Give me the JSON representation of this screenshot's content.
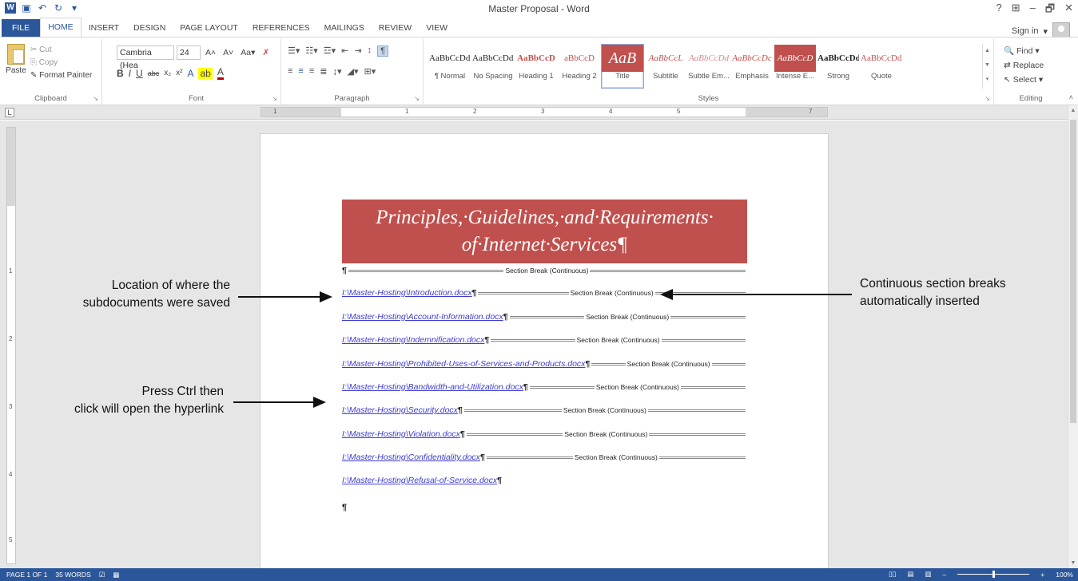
{
  "window": {
    "title": "Master Proposal - Word",
    "controls": [
      "?",
      "⊞",
      "–",
      "🗗",
      "✕"
    ],
    "sign_in": "Sign in"
  },
  "tabs": [
    "FILE",
    "HOME",
    "INSERT",
    "DESIGN",
    "PAGE LAYOUT",
    "REFERENCES",
    "MAILINGS",
    "REVIEW",
    "VIEW"
  ],
  "ribbon": {
    "clipboard": {
      "paste": "Paste",
      "cut": "Cut",
      "copy": "Copy",
      "format_painter": "Format Painter",
      "label": "Clipboard"
    },
    "font": {
      "name": "Cambria (Hea",
      "size": "24",
      "label": "Font"
    },
    "paragraph": {
      "label": "Paragraph"
    },
    "styles": {
      "label": "Styles",
      "items": [
        {
          "sample": "AaBbCcDdi",
          "name": "¶ Normal"
        },
        {
          "sample": "AaBbCcDdi",
          "name": "No Spacing"
        },
        {
          "sample": "AaBbCcD",
          "name": "Heading 1"
        },
        {
          "sample": "aBbCcD",
          "name": "Heading 2"
        },
        {
          "sample": "AaB",
          "name": "Title"
        },
        {
          "sample": "AaBbCcL",
          "name": "Subtitle"
        },
        {
          "sample": "AaBbCcDd",
          "name": "Subtle Em..."
        },
        {
          "sample": "AaBbCcDc",
          "name": "Emphasis"
        },
        {
          "sample": "AaBbCcD",
          "name": "Intense E..."
        },
        {
          "sample": "AaBbCcDd",
          "name": "Strong"
        },
        {
          "sample": "AaBbCcDdI",
          "name": "Quote"
        }
      ]
    },
    "editing": {
      "find": "Find",
      "replace": "Replace",
      "select": "Select",
      "label": "Editing"
    }
  },
  "document": {
    "title_line1": "Principles,·Guidelines,·and·Requirements·",
    "title_line2": "of·Internet·Services¶",
    "section_break": "Section Break (Continuous)",
    "subdocuments": [
      "I:\\Master-Hosting\\Introduction.docx",
      "I:\\Master-Hosting\\Account-Information.docx",
      "I:\\Master-Hosting\\Indemnification.docx",
      "I:\\Master-Hosting\\Prohibited-Uses-of-Services-and-Products.docx",
      "I:\\Master-Hosting\\Bandwidth-and-Utilization.docx",
      "I:\\Master-Hosting\\Security.docx",
      "I:\\Master-Hosting\\Violation.docx",
      "I:\\Master-Hosting\\Confidentiality.docx",
      "I:\\Master-Hosting\\Refusal-of-Service.docx"
    ],
    "pilcrow": "¶"
  },
  "callouts": {
    "location_line1": "Location of where the",
    "location_line2": "subdocuments were saved",
    "ctrl_line1": "Press Ctrl then",
    "ctrl_line2": "click will open the hyperlink",
    "breaks_line1": "Continuous section breaks",
    "breaks_line2": "automatically inserted"
  },
  "status": {
    "page": "PAGE 1 OF 1",
    "words": "35 WORDS",
    "zoom": "100%"
  },
  "colors": {
    "word_blue": "#2b579a",
    "title_red": "#c0504d",
    "link_blue": "#3b3bd0"
  }
}
